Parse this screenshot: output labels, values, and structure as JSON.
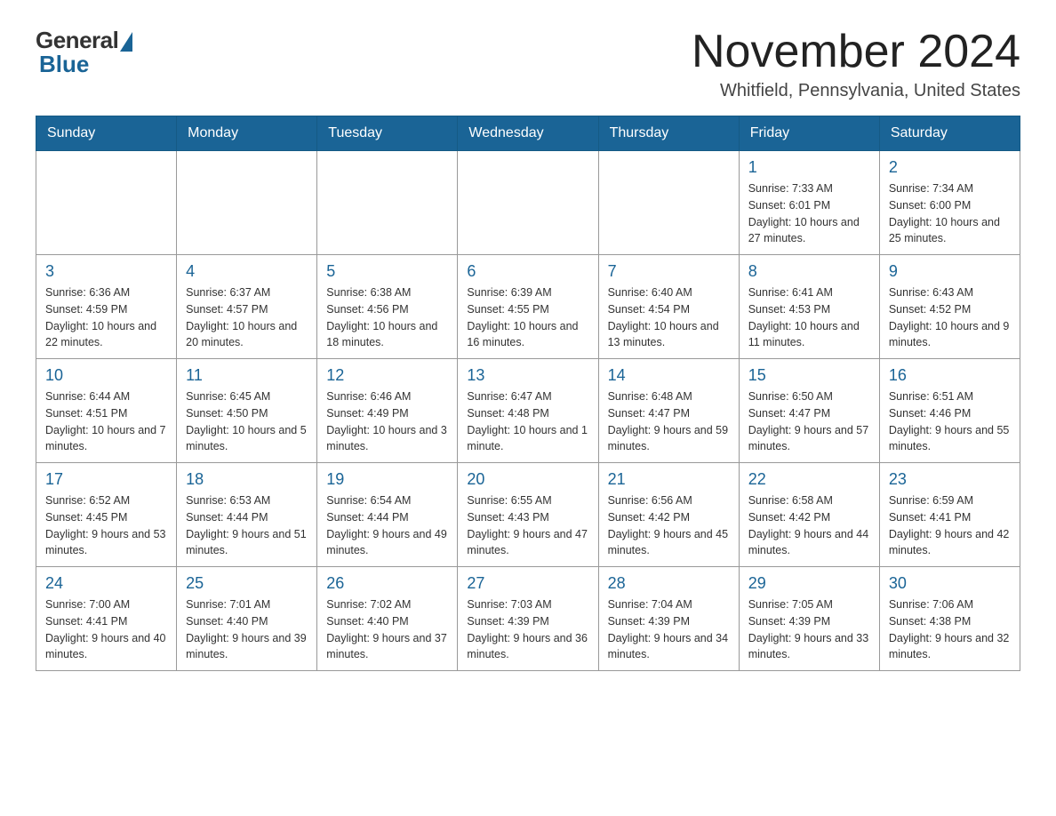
{
  "logo": {
    "general": "General",
    "blue": "Blue"
  },
  "title": "November 2024",
  "subtitle": "Whitfield, Pennsylvania, United States",
  "weekdays": [
    "Sunday",
    "Monday",
    "Tuesday",
    "Wednesday",
    "Thursday",
    "Friday",
    "Saturday"
  ],
  "weeks": [
    [
      {
        "day": "",
        "info": ""
      },
      {
        "day": "",
        "info": ""
      },
      {
        "day": "",
        "info": ""
      },
      {
        "day": "",
        "info": ""
      },
      {
        "day": "",
        "info": ""
      },
      {
        "day": "1",
        "info": "Sunrise: 7:33 AM\nSunset: 6:01 PM\nDaylight: 10 hours and 27 minutes."
      },
      {
        "day": "2",
        "info": "Sunrise: 7:34 AM\nSunset: 6:00 PM\nDaylight: 10 hours and 25 minutes."
      }
    ],
    [
      {
        "day": "3",
        "info": "Sunrise: 6:36 AM\nSunset: 4:59 PM\nDaylight: 10 hours and 22 minutes."
      },
      {
        "day": "4",
        "info": "Sunrise: 6:37 AM\nSunset: 4:57 PM\nDaylight: 10 hours and 20 minutes."
      },
      {
        "day": "5",
        "info": "Sunrise: 6:38 AM\nSunset: 4:56 PM\nDaylight: 10 hours and 18 minutes."
      },
      {
        "day": "6",
        "info": "Sunrise: 6:39 AM\nSunset: 4:55 PM\nDaylight: 10 hours and 16 minutes."
      },
      {
        "day": "7",
        "info": "Sunrise: 6:40 AM\nSunset: 4:54 PM\nDaylight: 10 hours and 13 minutes."
      },
      {
        "day": "8",
        "info": "Sunrise: 6:41 AM\nSunset: 4:53 PM\nDaylight: 10 hours and 11 minutes."
      },
      {
        "day": "9",
        "info": "Sunrise: 6:43 AM\nSunset: 4:52 PM\nDaylight: 10 hours and 9 minutes."
      }
    ],
    [
      {
        "day": "10",
        "info": "Sunrise: 6:44 AM\nSunset: 4:51 PM\nDaylight: 10 hours and 7 minutes."
      },
      {
        "day": "11",
        "info": "Sunrise: 6:45 AM\nSunset: 4:50 PM\nDaylight: 10 hours and 5 minutes."
      },
      {
        "day": "12",
        "info": "Sunrise: 6:46 AM\nSunset: 4:49 PM\nDaylight: 10 hours and 3 minutes."
      },
      {
        "day": "13",
        "info": "Sunrise: 6:47 AM\nSunset: 4:48 PM\nDaylight: 10 hours and 1 minute."
      },
      {
        "day": "14",
        "info": "Sunrise: 6:48 AM\nSunset: 4:47 PM\nDaylight: 9 hours and 59 minutes."
      },
      {
        "day": "15",
        "info": "Sunrise: 6:50 AM\nSunset: 4:47 PM\nDaylight: 9 hours and 57 minutes."
      },
      {
        "day": "16",
        "info": "Sunrise: 6:51 AM\nSunset: 4:46 PM\nDaylight: 9 hours and 55 minutes."
      }
    ],
    [
      {
        "day": "17",
        "info": "Sunrise: 6:52 AM\nSunset: 4:45 PM\nDaylight: 9 hours and 53 minutes."
      },
      {
        "day": "18",
        "info": "Sunrise: 6:53 AM\nSunset: 4:44 PM\nDaylight: 9 hours and 51 minutes."
      },
      {
        "day": "19",
        "info": "Sunrise: 6:54 AM\nSunset: 4:44 PM\nDaylight: 9 hours and 49 minutes."
      },
      {
        "day": "20",
        "info": "Sunrise: 6:55 AM\nSunset: 4:43 PM\nDaylight: 9 hours and 47 minutes."
      },
      {
        "day": "21",
        "info": "Sunrise: 6:56 AM\nSunset: 4:42 PM\nDaylight: 9 hours and 45 minutes."
      },
      {
        "day": "22",
        "info": "Sunrise: 6:58 AM\nSunset: 4:42 PM\nDaylight: 9 hours and 44 minutes."
      },
      {
        "day": "23",
        "info": "Sunrise: 6:59 AM\nSunset: 4:41 PM\nDaylight: 9 hours and 42 minutes."
      }
    ],
    [
      {
        "day": "24",
        "info": "Sunrise: 7:00 AM\nSunset: 4:41 PM\nDaylight: 9 hours and 40 minutes."
      },
      {
        "day": "25",
        "info": "Sunrise: 7:01 AM\nSunset: 4:40 PM\nDaylight: 9 hours and 39 minutes."
      },
      {
        "day": "26",
        "info": "Sunrise: 7:02 AM\nSunset: 4:40 PM\nDaylight: 9 hours and 37 minutes."
      },
      {
        "day": "27",
        "info": "Sunrise: 7:03 AM\nSunset: 4:39 PM\nDaylight: 9 hours and 36 minutes."
      },
      {
        "day": "28",
        "info": "Sunrise: 7:04 AM\nSunset: 4:39 PM\nDaylight: 9 hours and 34 minutes."
      },
      {
        "day": "29",
        "info": "Sunrise: 7:05 AM\nSunset: 4:39 PM\nDaylight: 9 hours and 33 minutes."
      },
      {
        "day": "30",
        "info": "Sunrise: 7:06 AM\nSunset: 4:38 PM\nDaylight: 9 hours and 32 minutes."
      }
    ]
  ]
}
